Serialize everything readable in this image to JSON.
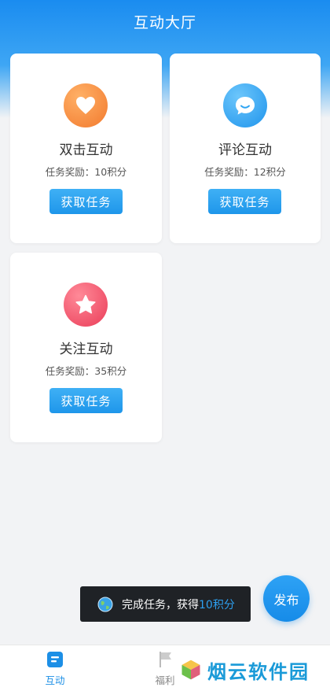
{
  "header": {
    "title": "互动大厅"
  },
  "cards": [
    {
      "title": "双击互动",
      "reward": "任务奖励：10积分",
      "button": "获取任务",
      "icon": "heart-icon",
      "color": "#f58a3a"
    },
    {
      "title": "评论互动",
      "reward": "任务奖励：12积分",
      "button": "获取任务",
      "icon": "comment-icon",
      "color": "#2ea4f2"
    },
    {
      "title": "关注互动",
      "reward": "任务奖励：35积分",
      "button": "获取任务",
      "icon": "star-icon",
      "color": "#f04a63"
    }
  ],
  "toast": {
    "prefix": "完成任务，获得",
    "highlight": "10积分"
  },
  "fab": {
    "label": "发布"
  },
  "tabbar": {
    "items": [
      {
        "label": "互动",
        "icon": "interact-icon",
        "active": true
      },
      {
        "label": "福利",
        "icon": "flag-icon",
        "active": false
      }
    ]
  },
  "watermark": {
    "text": "烟云软件园"
  },
  "colors": {
    "accent": "#1c8fe6",
    "header": "#1a8cf0"
  }
}
